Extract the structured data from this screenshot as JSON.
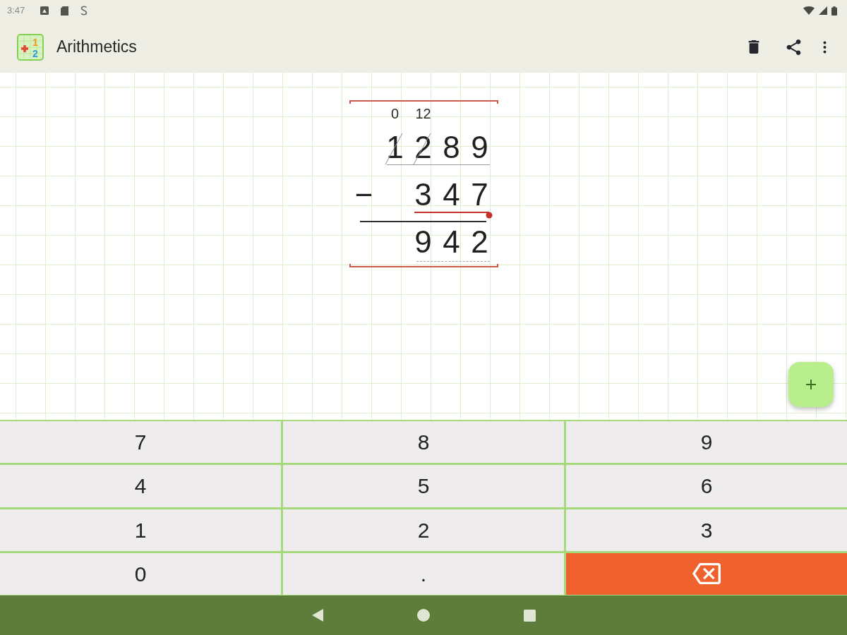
{
  "status_bar": {
    "time": "3:47"
  },
  "app_bar": {
    "logo_digits": [
      "1",
      "2"
    ],
    "title": "Arithmetics"
  },
  "worksheet": {
    "rows": [
      {
        "kind": "minuend",
        "selected": false,
        "digits": [
          {
            "digit": "1",
            "crossed": true,
            "borrow": "0"
          },
          {
            "digit": "2",
            "crossed": true,
            "borrow": "12"
          },
          {
            "digit": "8",
            "crossed": false
          },
          {
            "digit": "9",
            "crossed": false
          }
        ]
      },
      {
        "kind": "subtrahend",
        "selected": true,
        "operator": "−",
        "digits": [
          {
            "digit": "3"
          },
          {
            "digit": "4"
          },
          {
            "digit": "7"
          }
        ]
      },
      {
        "kind": "result",
        "selected": false,
        "digits": [
          {
            "digit": "9"
          },
          {
            "digit": "4"
          },
          {
            "digit": "2"
          }
        ]
      }
    ]
  },
  "keypad": [
    {
      "kind": "digit",
      "label": "7"
    },
    {
      "kind": "digit",
      "label": "8"
    },
    {
      "kind": "digit",
      "label": "9"
    },
    {
      "kind": "digit",
      "label": "4"
    },
    {
      "kind": "digit",
      "label": "5"
    },
    {
      "kind": "digit",
      "label": "6"
    },
    {
      "kind": "digit",
      "label": "1"
    },
    {
      "kind": "digit",
      "label": "2"
    },
    {
      "kind": "digit",
      "label": "3"
    },
    {
      "kind": "digit",
      "label": "0"
    },
    {
      "kind": "digit",
      "label": "."
    },
    {
      "kind": "backspace"
    }
  ]
}
